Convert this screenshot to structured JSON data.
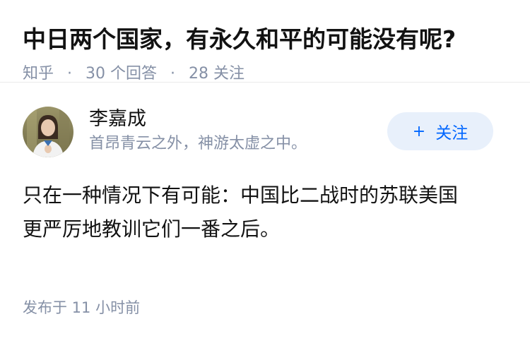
{
  "question": {
    "title": "中日两个国家，有永久和平的可能没有呢?",
    "source": "知乎",
    "answer_count": "30 个回答",
    "follower_count": "28 关注"
  },
  "answer": {
    "author": {
      "name": "李嘉成",
      "headline": "首昂青云之外，神游太虚之中。",
      "avatar": "avatar-photo"
    },
    "follow_button": {
      "icon": "plus-icon",
      "label": "关注",
      "plus": "+"
    },
    "content_line_1": "只在一种情况下有可能：中国比二战时的苏联美国",
    "content_line_2": "更严厉地教训它们一番之后。",
    "publish_time": "发布于 11 小时前"
  },
  "colors": {
    "text_primary": "#121212",
    "text_secondary": "#8590a6",
    "accent": "#0066ff",
    "follow_bg": "#e8f0fb"
  }
}
